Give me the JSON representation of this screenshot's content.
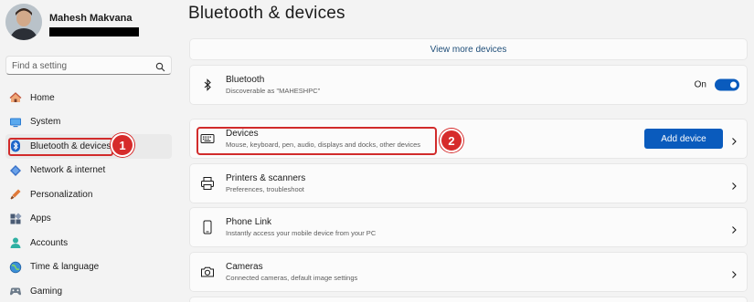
{
  "sidebar": {
    "user": {
      "name": "Mahesh Makvana"
    },
    "search": {
      "placeholder": "Find a setting"
    },
    "items": [
      {
        "label": "Home",
        "icon": "home-icon"
      },
      {
        "label": "System",
        "icon": "system-icon"
      },
      {
        "label": "Bluetooth & devices",
        "icon": "bluetooth-icon",
        "active": true
      },
      {
        "label": "Network & internet",
        "icon": "network-icon"
      },
      {
        "label": "Personalization",
        "icon": "personalization-icon"
      },
      {
        "label": "Apps",
        "icon": "apps-icon"
      },
      {
        "label": "Accounts",
        "icon": "accounts-icon"
      },
      {
        "label": "Time & language",
        "icon": "time-language-icon"
      },
      {
        "label": "Gaming",
        "icon": "gaming-icon"
      }
    ]
  },
  "main": {
    "title": "Bluetooth & devices",
    "view_more": "View more devices",
    "bluetooth": {
      "title": "Bluetooth",
      "subtitle": "Discoverable as \"MAHESHPC\"",
      "state_label": "On",
      "enabled": true
    },
    "devices": {
      "title": "Devices",
      "subtitle": "Mouse, keyboard, pen, audio, displays and docks, other devices",
      "button": "Add device"
    },
    "printers": {
      "title": "Printers & scanners",
      "subtitle": "Preferences, troubleshoot"
    },
    "phone_link": {
      "title": "Phone Link",
      "subtitle": "Instantly access your mobile device from your PC"
    },
    "cameras": {
      "title": "Cameras",
      "subtitle": "Connected cameras, default image settings"
    }
  },
  "annotations": {
    "badge_1": "1",
    "badge_2": "2"
  },
  "colors": {
    "accent": "#0a5bbd",
    "highlight": "#d12b2b",
    "background": "#f3f3f3",
    "card": "#fbfbfb"
  }
}
